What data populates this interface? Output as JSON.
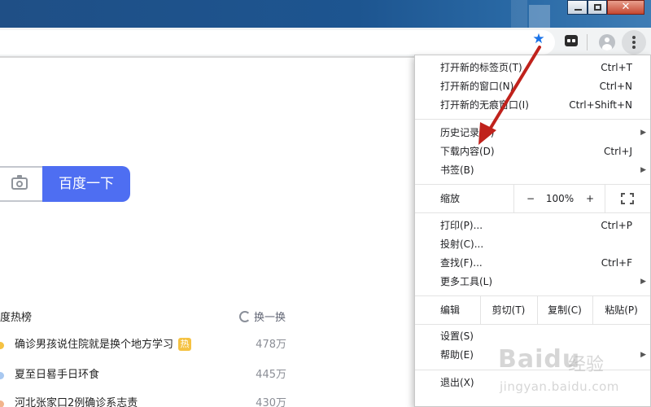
{
  "window": {
    "close_glyph": "✕"
  },
  "toolbar": {
    "star_glyph": "★"
  },
  "page": {
    "search_button": "百度一下",
    "hot": {
      "title": "度热榜",
      "refresh": "换一换",
      "items": [
        {
          "text": "确诊男孩说住院就是换个地方学习",
          "badge": "热",
          "count": "478万",
          "dot_color": "#f5c242"
        },
        {
          "text": "夏至日晷手日环食",
          "badge": "",
          "count": "445万",
          "dot_color": "#a8c8f0"
        },
        {
          "text": "河北张家口2例确诊系志责",
          "badge": "",
          "count": "430万",
          "dot_color": "#f2b48c"
        }
      ]
    }
  },
  "menu": {
    "items_group1": [
      {
        "label": "打开新的标签页(T)",
        "shortcut": "Ctrl+T"
      },
      {
        "label": "打开新的窗口(N)",
        "shortcut": "Ctrl+N"
      },
      {
        "label": "打开新的无痕窗口(I)",
        "shortcut": "Ctrl+Shift+N"
      }
    ],
    "items_group2": [
      {
        "label": "历史记录(H)",
        "shortcut": "",
        "submenu": true
      },
      {
        "label": "下载内容(D)",
        "shortcut": "Ctrl+J",
        "submenu": false
      },
      {
        "label": "书签(B)",
        "shortcut": "",
        "submenu": true
      }
    ],
    "zoom": {
      "label": "缩放",
      "minus": "−",
      "value": "100%",
      "plus": "+"
    },
    "items_group3": [
      {
        "label": "打印(P)...",
        "shortcut": "Ctrl+P",
        "submenu": false
      },
      {
        "label": "投射(C)...",
        "shortcut": "",
        "submenu": false
      },
      {
        "label": "查找(F)...",
        "shortcut": "Ctrl+F",
        "submenu": false
      },
      {
        "label": "更多工具(L)",
        "shortcut": "",
        "submenu": true
      }
    ],
    "edit": {
      "label": "编辑",
      "cut": "剪切(T)",
      "copy": "复制(C)",
      "paste": "粘贴(P)"
    },
    "items_group4": [
      {
        "label": "设置(S)",
        "submenu": false
      },
      {
        "label": "帮助(E)",
        "submenu": true
      }
    ],
    "exit": "退出(X)",
    "submenu_arrow": "▶"
  },
  "watermark": {
    "logo": "Baidu",
    "text": "经验",
    "url": "jingyan.baidu.com"
  },
  "colors": {
    "accent": "#4e6ef2",
    "annotation_arrow": "#c0221c",
    "star": "#1a73e8"
  }
}
